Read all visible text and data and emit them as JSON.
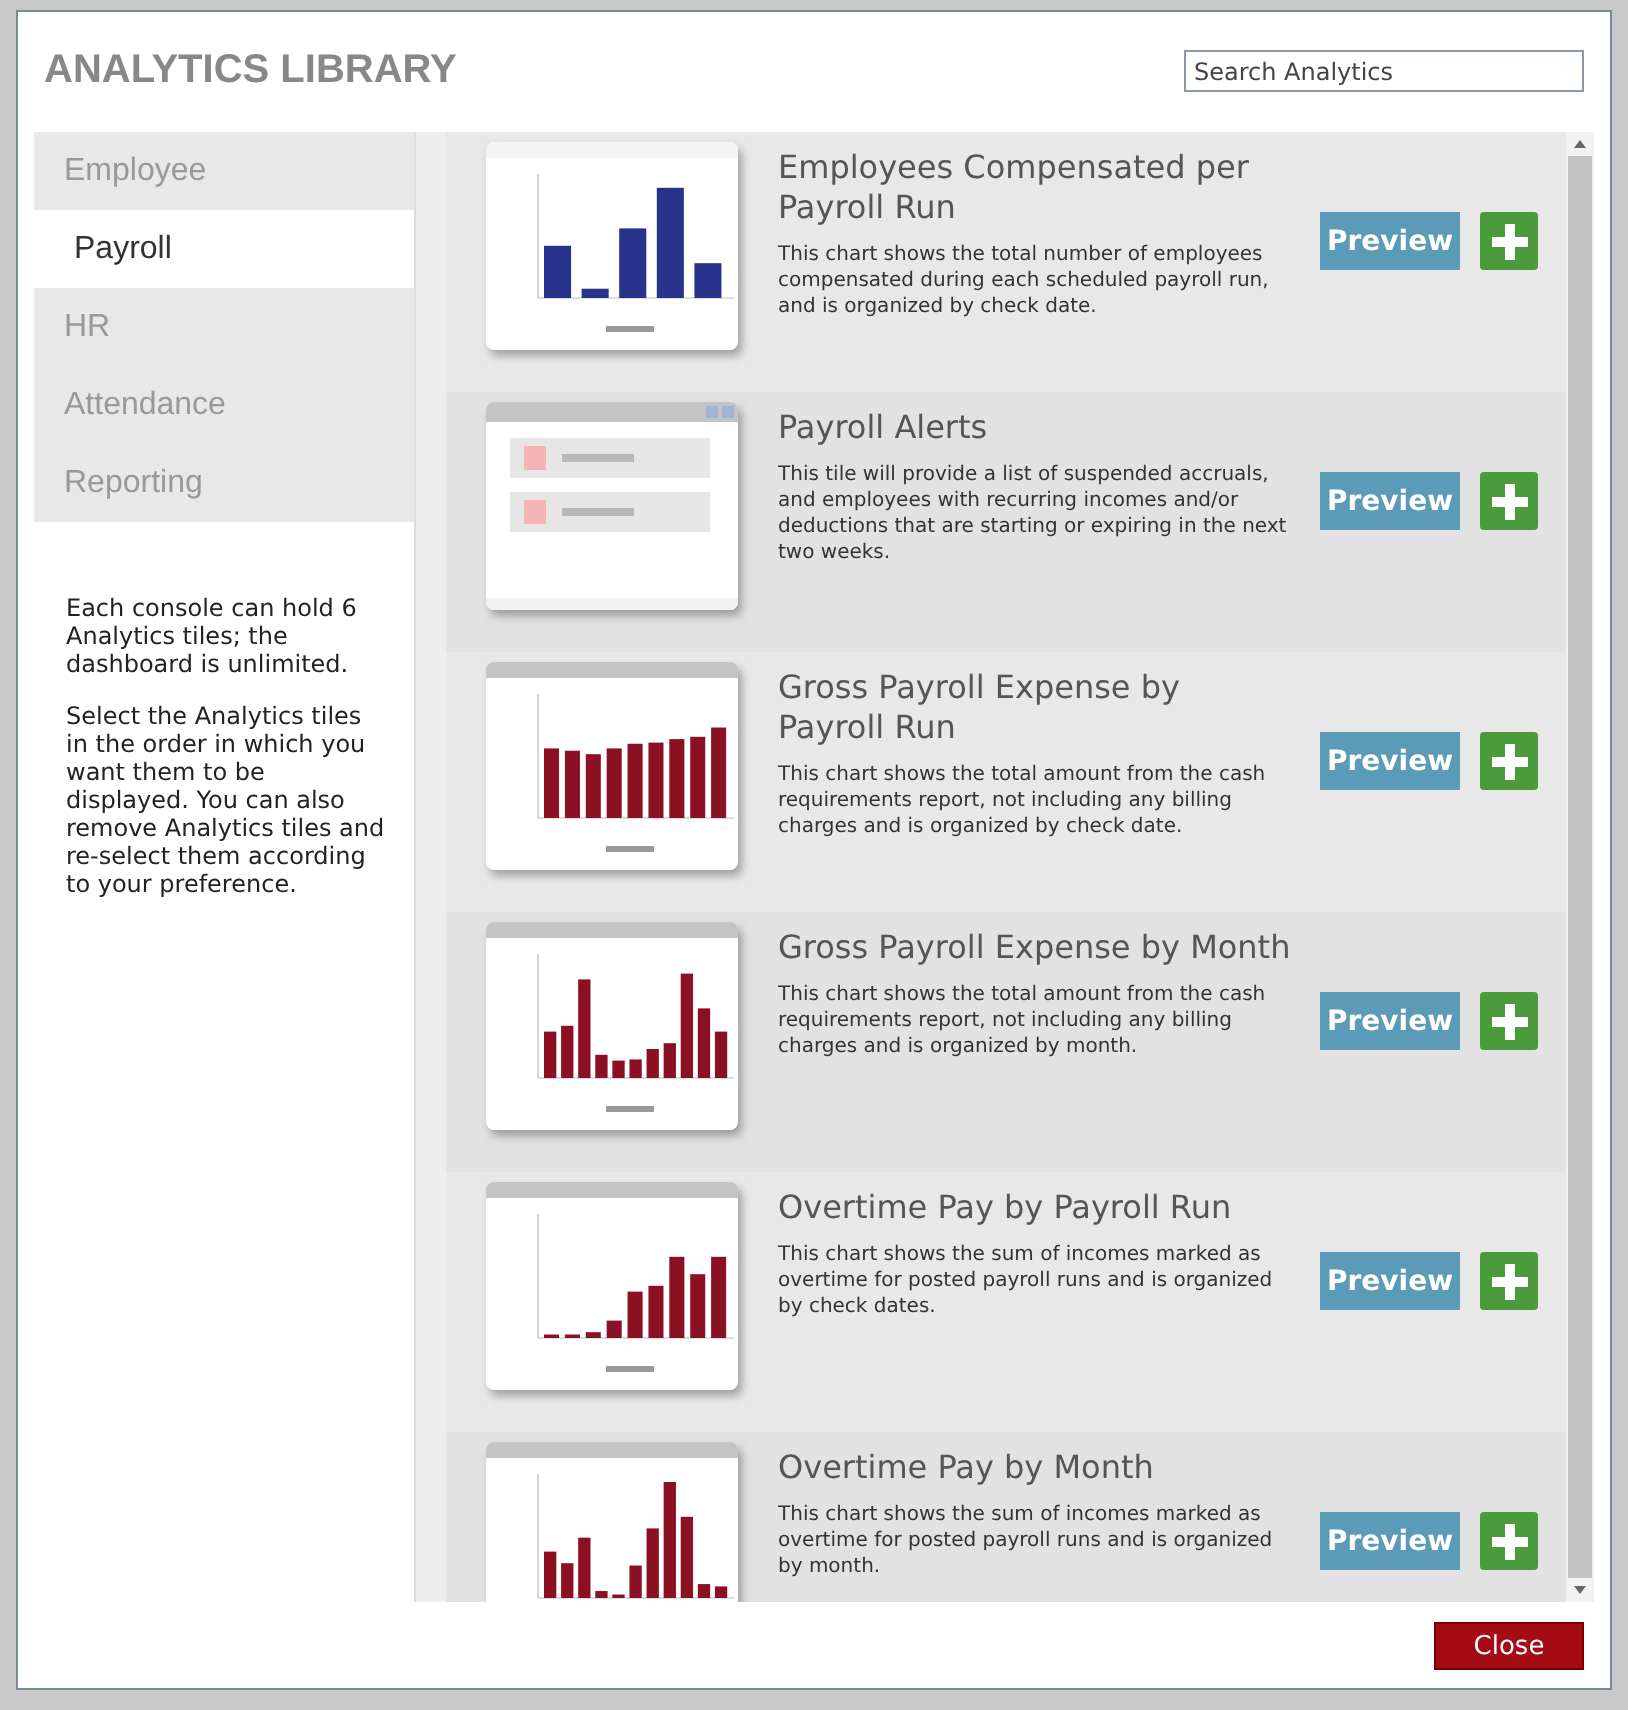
{
  "dialog": {
    "title": "ANALYTICS LIBRARY",
    "search": {
      "placeholder": "Search Analytics"
    }
  },
  "categories": [
    {
      "label": "Employee",
      "selected": false
    },
    {
      "label": "Payroll",
      "selected": true
    },
    {
      "label": "HR",
      "selected": false
    },
    {
      "label": "Attendance",
      "selected": false
    },
    {
      "label": "Reporting",
      "selected": false
    }
  ],
  "help": [
    "Each console can hold 6 Analytics tiles; the dashboard is unlimited.",
    "Select the Analytics tiles in the order in which you want them to be displayed. You can also remove Analytics tiles and re-select them according to your preference."
  ],
  "tiles": [
    {
      "title": "Employees Compensated per Payroll Run",
      "description": "This chart shows the total number of employees compensated during each scheduled payroll run, and is organized by check date.",
      "preview": "Preview"
    },
    {
      "title": "Payroll Alerts",
      "description": "This tile will provide a list of suspended accruals, and employees with recurring incomes and/or deductions that are starting or expiring in the next two weeks.",
      "preview": "Preview"
    },
    {
      "title": "Gross Payroll Expense by Payroll Run",
      "description": "This chart shows the total amount from the cash requirements report, not including any billing charges and is organized by check date.",
      "preview": "Preview"
    },
    {
      "title": "Gross Payroll Expense by Month",
      "description": "This chart shows the total amount from the cash requirements report, not including any billing charges and is organized by month.",
      "preview": "Preview"
    },
    {
      "title": "Overtime Pay by Payroll Run",
      "description": "This chart shows the sum of incomes marked as overtime for posted payroll runs and is organized by check dates.",
      "preview": "Preview"
    },
    {
      "title": "Overtime Pay by Month",
      "description": "This chart shows the sum of incomes marked as overtime for posted payroll runs and is organized by month.",
      "preview": "Preview"
    }
  ],
  "footer": {
    "close": "Close"
  }
}
